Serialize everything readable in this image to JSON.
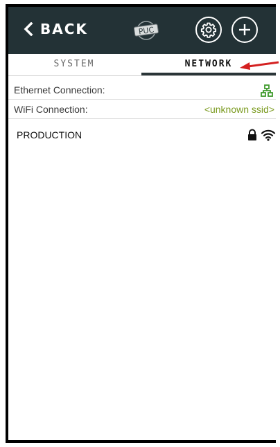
{
  "header": {
    "back_label": "BACK",
    "logo_text": "PUC",
    "icons": [
      "chevron-left-icon",
      "puc-logo",
      "gear-icon",
      "plus-icon"
    ]
  },
  "tabs": [
    {
      "label": "SYSTEM",
      "active": false
    },
    {
      "label": "NETWORK",
      "active": true
    }
  ],
  "connections": {
    "ethernet": {
      "label": "Ethernet Connection:",
      "icon": "ethernet-connected-icon"
    },
    "wifi": {
      "label": "WiFi Connection:",
      "value": "<unknown ssid>"
    }
  },
  "networks": [
    {
      "ssid": "PRODUCTION",
      "secured": true,
      "icons": [
        "lock-icon",
        "wifi-signal-icon"
      ]
    }
  ],
  "colors": {
    "header_bg": "#233236",
    "value_green": "#7a9a1e",
    "annotation_arrow": "#d42020"
  }
}
